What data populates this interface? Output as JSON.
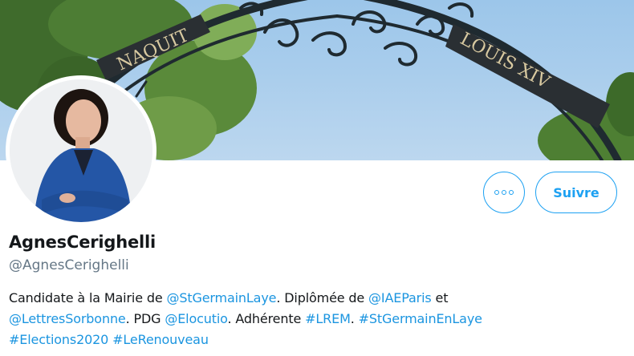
{
  "profile": {
    "display_name": "AgnesCerighelli",
    "handle": "@AgnesCerighelli"
  },
  "banner": {
    "sign_left": "NAQUIT",
    "sign_right": "LOUIS XIV"
  },
  "actions": {
    "more_label": "More actions",
    "follow_label": "Suivre"
  },
  "bio": {
    "line1": [
      {
        "text": "Candidate à la Mairie de ",
        "link": false
      },
      {
        "text": "@StGermainLaye",
        "link": true
      },
      {
        "text": ". Diplômée de ",
        "link": false
      },
      {
        "text": "@IAEParis",
        "link": true
      },
      {
        "text": " et",
        "link": false
      }
    ],
    "line2": [
      {
        "text": "@LettresSorbonne",
        "link": true
      },
      {
        "text": ". PDG ",
        "link": false
      },
      {
        "text": "@Elocutio",
        "link": true
      },
      {
        "text": ". Adhérente ",
        "link": false
      },
      {
        "text": "#LREM",
        "link": true
      },
      {
        "text": ". ",
        "link": false
      },
      {
        "text": "#StGermainEnLaye",
        "link": true
      }
    ],
    "line3": [
      {
        "text": "#Elections2020",
        "link": true
      },
      {
        "text": " ",
        "link": false
      },
      {
        "text": "#LeRenouveau",
        "link": true
      }
    ]
  },
  "colors": {
    "accent": "#1da1f2",
    "link": "#1b95e0",
    "secondary_text": "#657786"
  }
}
